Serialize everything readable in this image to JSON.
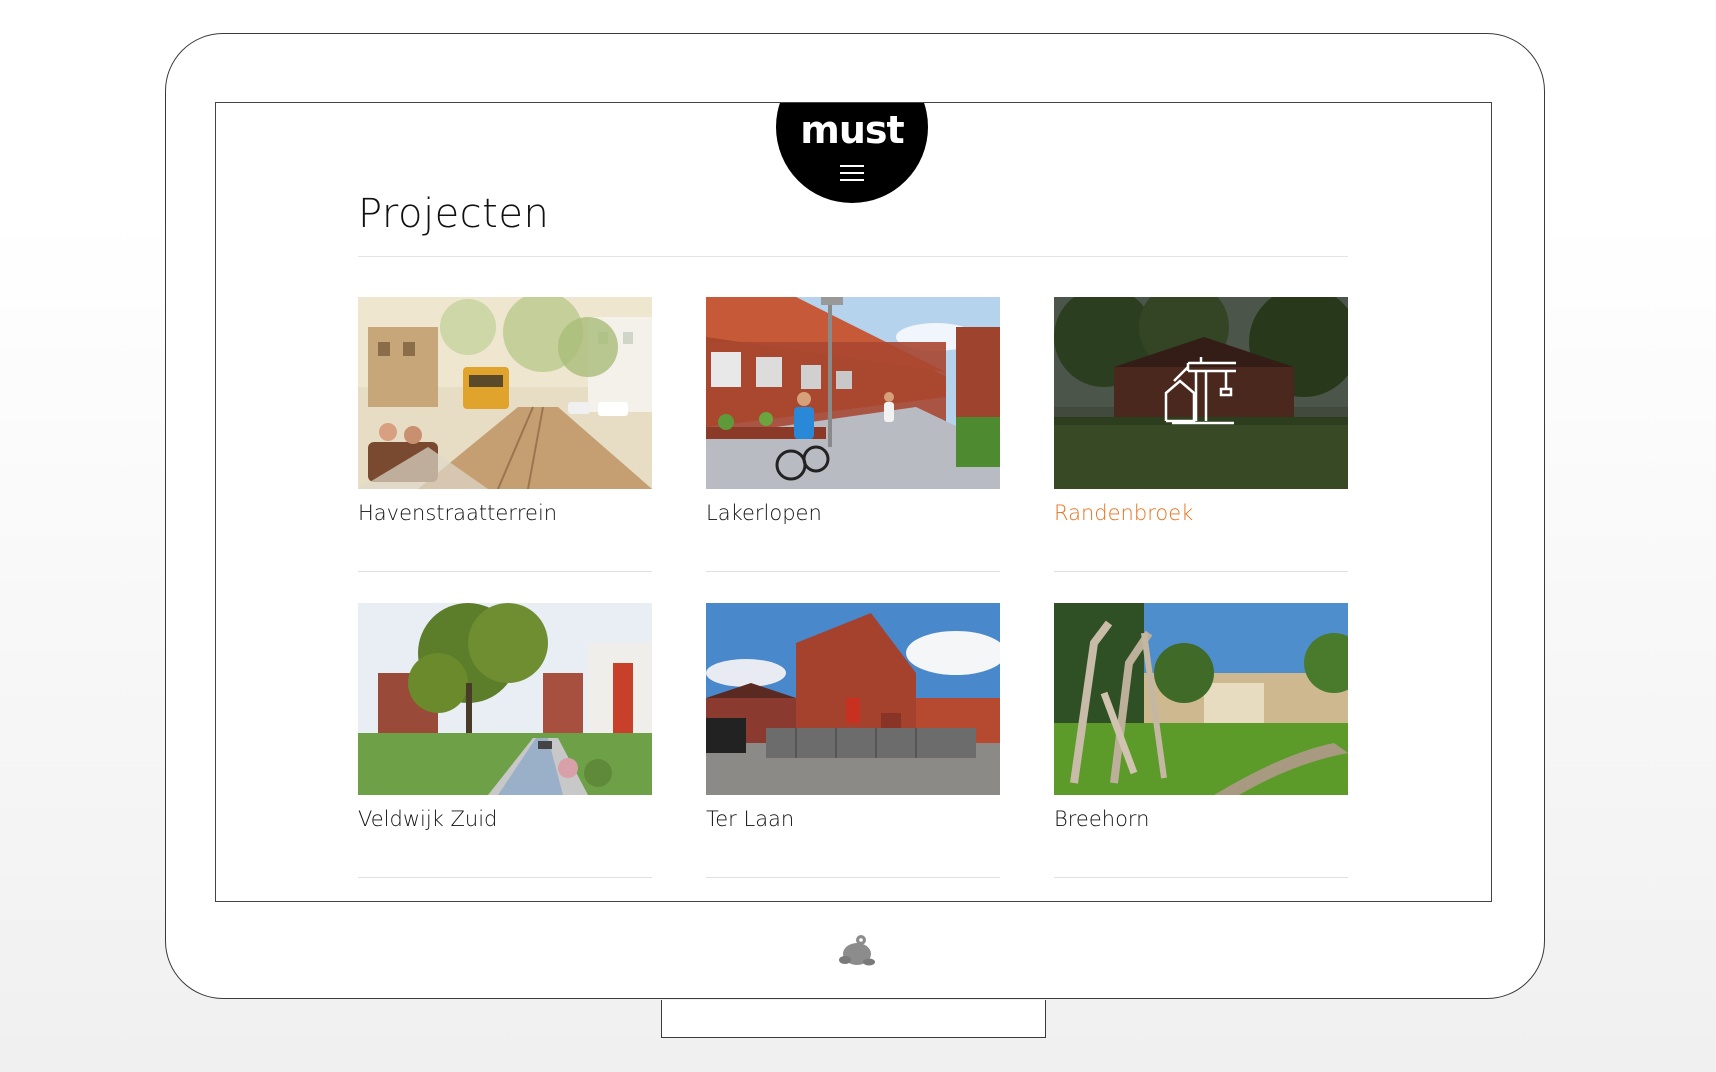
{
  "site": {
    "logo_text": "must",
    "menu_icon": "hamburger-icon"
  },
  "page": {
    "title": "Projecten"
  },
  "projects": [
    {
      "title": "Havenstraatterrein",
      "active": false
    },
    {
      "title": "Lakerlopen",
      "active": false
    },
    {
      "title": "Randenbroek",
      "active": true,
      "overlay_icon": "construction-crane-house-icon"
    },
    {
      "title": "Veldwijk Zuid",
      "active": false
    },
    {
      "title": "Ter Laan",
      "active": false
    },
    {
      "title": "Breehorn",
      "active": false
    }
  ],
  "colors": {
    "accent": "#e8721c",
    "logo_bg": "#000000",
    "text": "#111111"
  },
  "device": {
    "logo_icon": "frog-icon"
  }
}
